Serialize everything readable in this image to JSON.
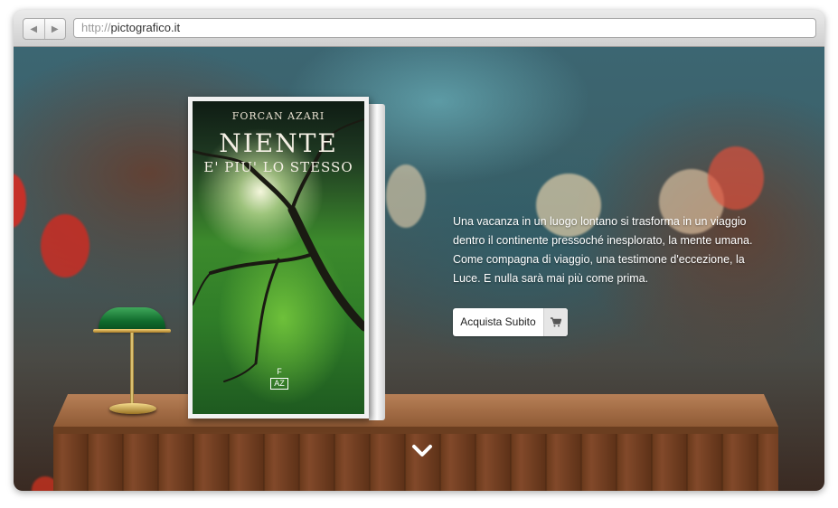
{
  "browser": {
    "url_protocol": "http://",
    "url_domain": "pictografico.it",
    "back_icon": "chevron-left-icon",
    "forward_icon": "chevron-right-icon"
  },
  "book": {
    "author": "FORCAN AZARI",
    "title": "NIENTE",
    "subtitle": "E' PIU' LO STESSO",
    "publisher_logo_top": "F",
    "publisher_logo_bottom": "AZ"
  },
  "description": "Una vacanza in un luogo lontano si trasforma in un viaggio dentro il continente pressoché inesplorato, la mente umana. Come compagna di viaggio, una testimone d'eccezione, la Luce. E nulla sarà mai più come prima.",
  "buy_button": {
    "label": "Acquista Subito",
    "icon": "cart-icon"
  },
  "scroll": {
    "icon": "chevron-down-icon"
  },
  "colors": {
    "lamp_green": "#0f6a2c",
    "table_wood": "#8f5a35",
    "text_white": "#ffffff"
  }
}
